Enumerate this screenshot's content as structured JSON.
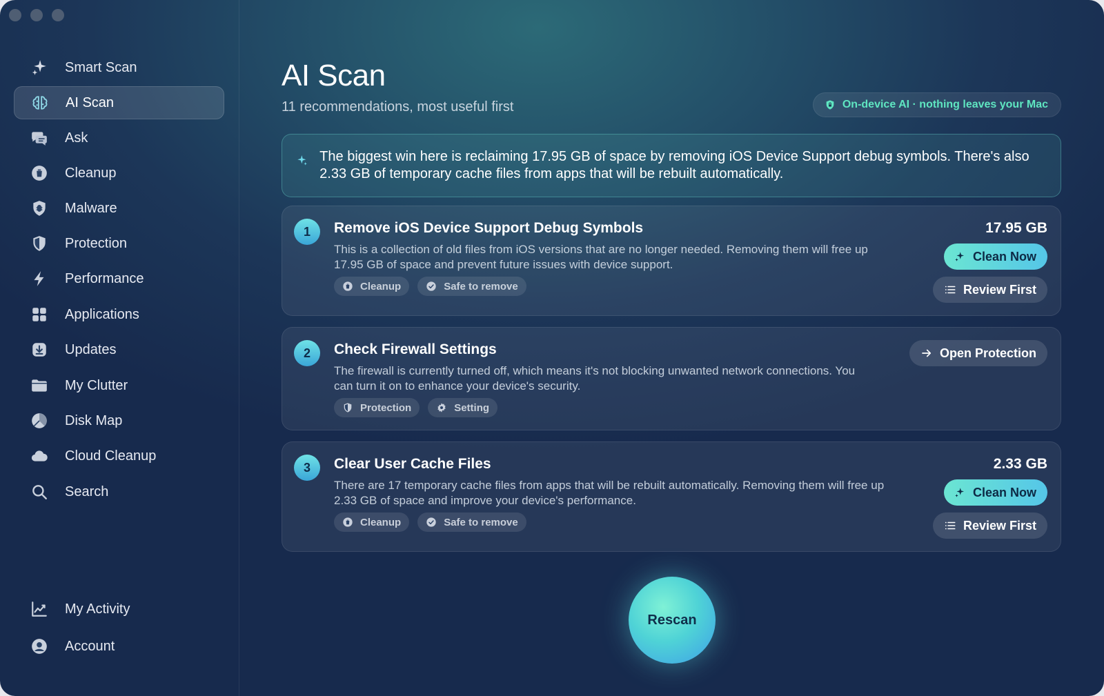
{
  "sidebar": {
    "items": [
      {
        "label": "Smart Scan",
        "icon": "sparkle-icon"
      },
      {
        "label": "AI Scan",
        "icon": "brain-icon",
        "active": true
      },
      {
        "label": "Ask",
        "icon": "chat-bubbles-icon"
      },
      {
        "label": "Cleanup",
        "icon": "trash-icon"
      },
      {
        "label": "Malware",
        "icon": "bug-shield-icon"
      },
      {
        "label": "Protection",
        "icon": "shield-icon"
      },
      {
        "label": "Performance",
        "icon": "bolt-icon"
      },
      {
        "label": "Applications",
        "icon": "grid-icon"
      },
      {
        "label": "Updates",
        "icon": "download-icon"
      },
      {
        "label": "My Clutter",
        "icon": "folder-icon"
      },
      {
        "label": "Disk Map",
        "icon": "pie-icon"
      },
      {
        "label": "Cloud Cleanup",
        "icon": "cloud-icon"
      },
      {
        "label": "Search",
        "icon": "search-icon"
      }
    ],
    "bottom": [
      {
        "label": "My Activity",
        "icon": "activity-chart-icon"
      },
      {
        "label": "Account",
        "icon": "user-circle-icon"
      }
    ]
  },
  "main": {
    "title": "AI Scan",
    "subtitle": "11 recommendations, most useful first",
    "privacy": "On-device AI · nothing leaves your Mac",
    "insight": "The biggest win here is reclaiming 17.95 GB of space by removing iOS Device Support debug symbols. There's also 2.33 GB of temporary cache files from apps that will be rebuilt automatically.",
    "cards": [
      {
        "number": "1",
        "title": "Remove iOS Device Support Debug Symbols",
        "description": "This is a collection of old files from iOS versions that are no longer needed. Removing them will free up 17.95 GB of space and prevent future issues with device support.",
        "tags": [
          "Cleanup",
          "Safe to remove"
        ],
        "size": "17.95 GB",
        "primary_action": "Clean Now",
        "secondary_action": "Review First"
      },
      {
        "number": "2",
        "title": "Check Firewall Settings",
        "description": "The firewall is currently turned off, which means it's not blocking unwanted network connections. You can turn it on to enhance your device's security.",
        "tags": [
          "Protection",
          "Setting"
        ],
        "action": "Open Protection"
      },
      {
        "number": "3",
        "title": "Clear User Cache Files",
        "description": "There are 17 temporary cache files from apps that will be rebuilt automatically. Removing them will free up 2.33 GB of space and improve your device's performance.",
        "tags": [
          "Cleanup",
          "Safe to remove"
        ],
        "size": "2.33 GB",
        "primary_action": "Clean Now",
        "secondary_action": "Review First"
      }
    ],
    "rescan_label": "Rescan"
  },
  "colors": {
    "accent": "#5fe6c1",
    "primary_button": "#6be5d2",
    "number_badge": "#4fc3de"
  }
}
